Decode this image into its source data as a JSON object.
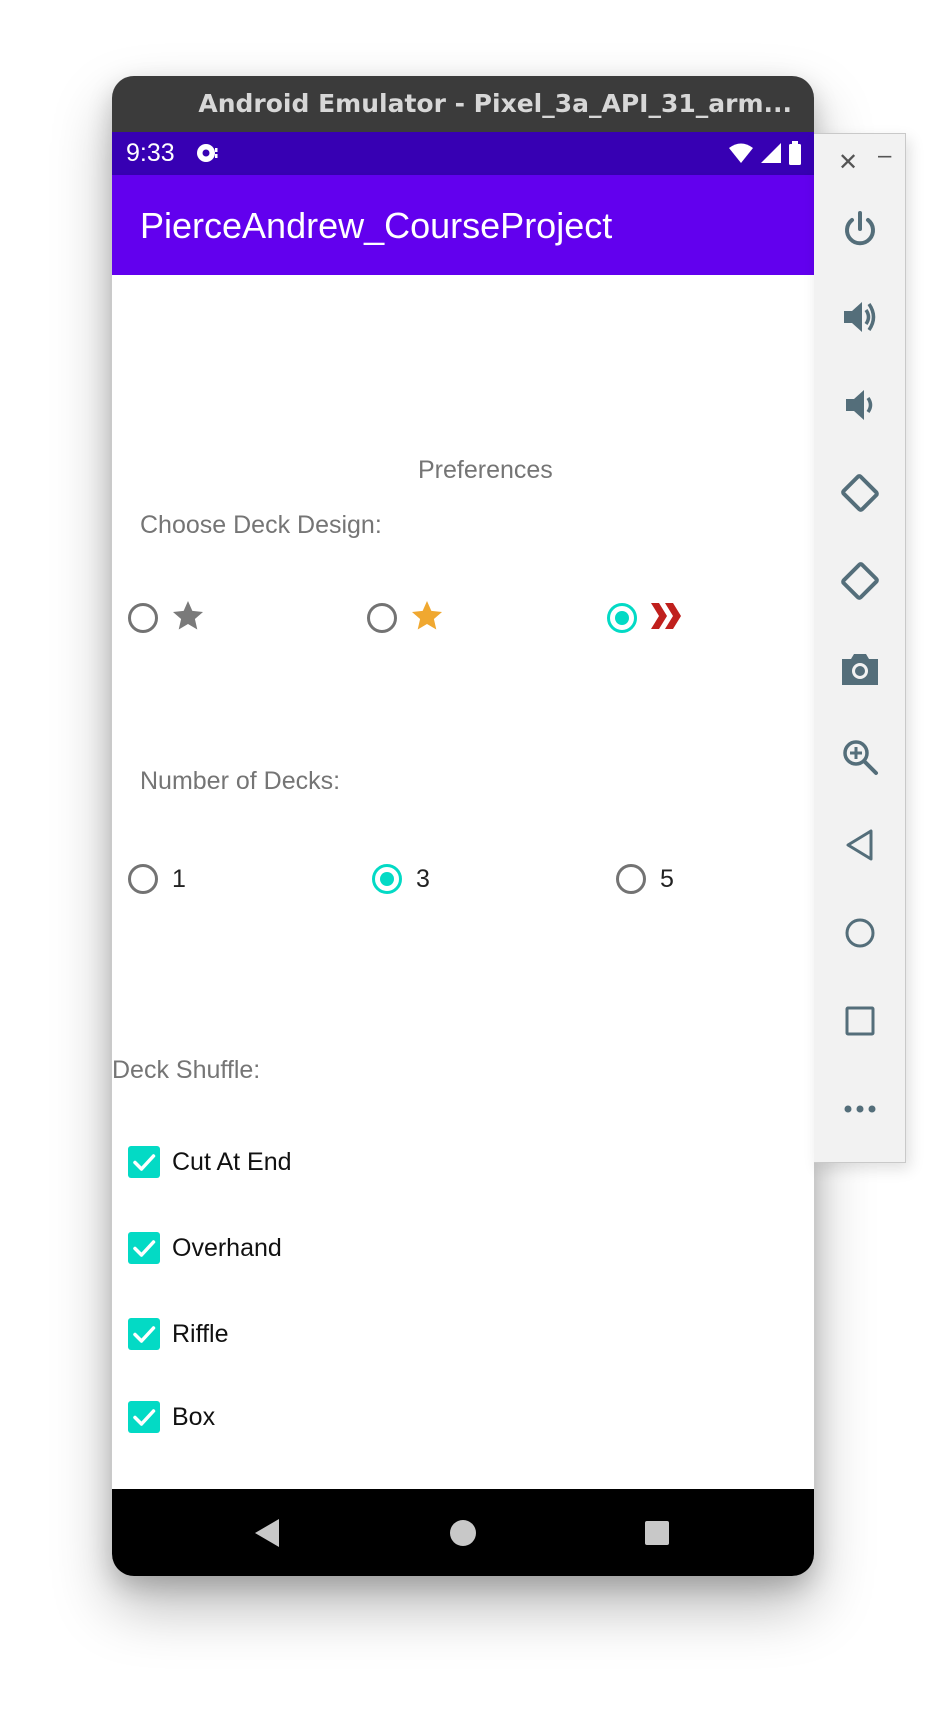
{
  "window": {
    "title": "Android Emulator - Pixel_3a_API_31_arm..."
  },
  "status_bar": {
    "time": "9:33"
  },
  "app_bar": {
    "title": "PierceAndrew_CourseProject"
  },
  "preferences": {
    "heading": "Preferences",
    "deck_design": {
      "label": "Choose Deck Design:",
      "options": [
        {
          "icon": "gray-star-icon",
          "color": "#7a7a7a",
          "selected": false
        },
        {
          "icon": "gold-star-icon",
          "color": "#f0a830",
          "selected": false
        },
        {
          "icon": "red-chevrons-icon",
          "color": "#c0201d",
          "selected": true
        }
      ]
    },
    "number_of_decks": {
      "label": "Number of Decks:",
      "options": [
        {
          "label": "1",
          "selected": false
        },
        {
          "label": "3",
          "selected": true
        },
        {
          "label": "5",
          "selected": false
        }
      ]
    },
    "deck_shuffle": {
      "label": "Deck Shuffle:",
      "options": [
        {
          "label": "Cut At End",
          "checked": true
        },
        {
          "label": "Overhand",
          "checked": true
        },
        {
          "label": "Riffle",
          "checked": true
        },
        {
          "label": "Box",
          "checked": true
        }
      ]
    }
  },
  "colors": {
    "status_bar": "#3700b3",
    "app_bar": "#6200ee",
    "accent": "#03dac5",
    "titlebar": "#3b3b3b"
  },
  "side_toolbar": {
    "icons": [
      "close-icon",
      "minimize-icon",
      "power-icon",
      "volume-up-icon",
      "volume-down-icon",
      "rotate-left-icon",
      "rotate-right-icon",
      "camera-icon",
      "zoom-icon",
      "back-icon",
      "home-icon",
      "overview-icon",
      "more-icon"
    ]
  }
}
